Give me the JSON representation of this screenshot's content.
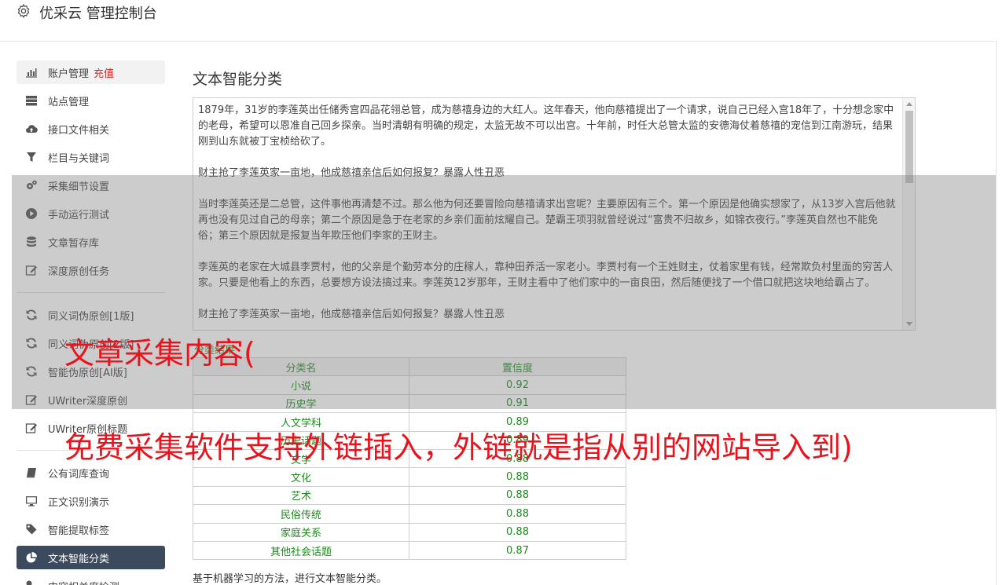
{
  "header": {
    "title": "优采云 管理控制台",
    "icon": "gear-icon"
  },
  "sidebar": {
    "items": [
      {
        "label": "账户管理",
        "accent": "充值",
        "icon": "bar-chart-icon"
      },
      {
        "label": "站点管理",
        "icon": "server-icon"
      },
      {
        "label": "接口文件相关",
        "icon": "cloud-upload-icon"
      },
      {
        "label": "栏目与关键词",
        "icon": "filter-icon"
      },
      {
        "label": "采集细节设置",
        "icon": "gears-icon"
      },
      {
        "label": "手动运行测试",
        "icon": "play-circle-icon"
      },
      {
        "label": "文章暂存库",
        "icon": "database-icon"
      },
      {
        "label": "深度原创任务",
        "icon": "edit-icon"
      },
      {
        "label": "同义词伪原创[1版]",
        "icon": "refresh-icon"
      },
      {
        "label": "同义词伪原创[2版]",
        "icon": "refresh-icon"
      },
      {
        "label": "智能伪原创[AI版]",
        "icon": "refresh-icon"
      },
      {
        "label": "UWriter深度原创",
        "icon": "edit-icon"
      },
      {
        "label": "UWriter原创标题",
        "icon": "edit-icon"
      },
      {
        "label": "公有词库查询",
        "icon": "book-icon"
      },
      {
        "label": "正文识别演示",
        "icon": "monitor-icon"
      },
      {
        "label": "智能提取标签",
        "icon": "tag-icon"
      },
      {
        "label": "文本智能分类",
        "icon": "pie-chart-icon"
      },
      {
        "label": "内容相关度检测",
        "icon": "key-icon"
      }
    ]
  },
  "main": {
    "title": "文本智能分类",
    "text_paragraphs": [
      "1879年，31岁的李莲英出任储秀宫四品花翎总管，成为慈禧身边的大红人。这年春天，他向慈禧提出了一个请求，说自己已经入宫18年了，十分想念家中的老母，希望可以恩准自己回乡探亲。当时清朝有明确的规定，太监无故不可以出宫。十年前，时任大总管太监的安德海仗着慈禧的宠信到江南游玩，结果刚到山东就被丁宝桢给砍了。",
      "财主抢了李莲英家一亩地，他成慈禧亲信后如何报复？暴露人性丑恶",
      "当时李莲英还是二总管，这件事他再清楚不过。那么他为何还要冒险向慈禧请求出宫呢？主要原因有三个。第一个原因是他确实想家了，从13岁入宫后他就再也没有见过自己的母亲；第二个原因是急于在老家的乡亲们面前炫耀自己。楚霸王项羽就曾经说过“富贵不归故乡，如锦衣夜行。”李莲英自然也不能免俗；第三个原因就是报复当年欺压他们李家的王财主。",
      "李莲英的老家在大城县李贾村，他的父亲是个勤劳本分的庄稼人，靠种田养活一家老小。李贾村有一个王姓财主，仗着家里有钱，经常欺负村里面的穷苦人家。只要是他看上的东西，总要想方设法搞过来。李莲英12岁那年，王财主看中了他们家中的一亩良田，然后随便找了一个借口就把这块地给霸占了。",
      "财主抢了李莲英家一亩地，他成慈禧亲信后如何报复？暴露人性丑恶"
    ],
    "result_label": "分类结果",
    "table": {
      "headers": [
        "分类名",
        "置信度"
      ],
      "rows": [
        [
          "小说",
          "0.92"
        ],
        [
          "历史学",
          "0.91"
        ],
        [
          "人文学科",
          "0.89"
        ],
        [
          "历史话题",
          "0.89"
        ],
        [
          "文学",
          "0.88"
        ],
        [
          "文化",
          "0.88"
        ],
        [
          "艺术",
          "0.88"
        ],
        [
          "民俗传统",
          "0.88"
        ],
        [
          "家庭关系",
          "0.88"
        ],
        [
          "其他社会话题",
          "0.87"
        ]
      ]
    },
    "footnote": "基于机器学习的方法，进行文本智能分类。"
  },
  "overlay_text": {
    "line1": "文章采集内容(",
    "line2": "免费采集软件支持外链插入，外链就是指从别的网站导入到)"
  },
  "colors": {
    "accent_red": "#e02020",
    "active_nav": "#3b4a5c",
    "result_green": "#1e8a1e",
    "overlay_red": "#e8131c"
  }
}
